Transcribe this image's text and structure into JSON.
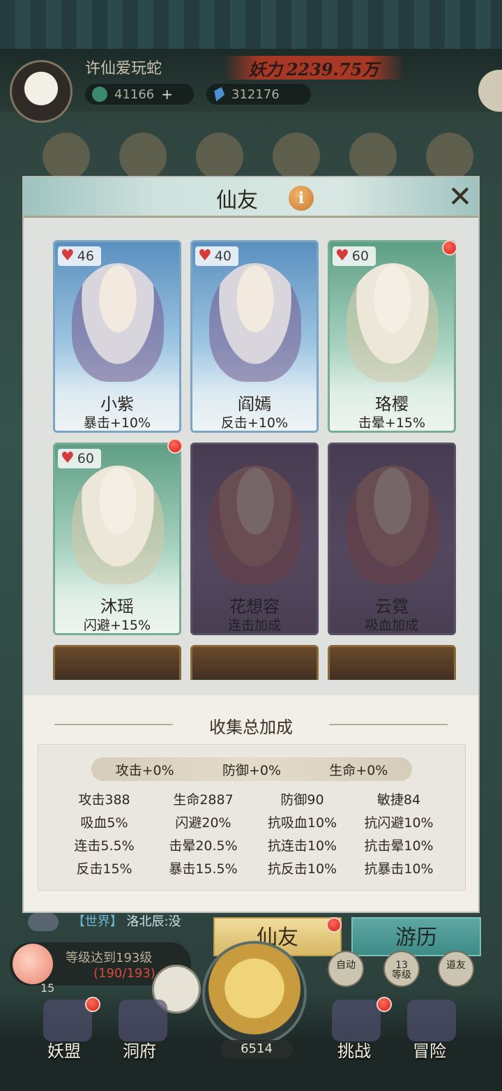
{
  "player": {
    "name": "许仙爱玩蛇",
    "power_label": "妖力",
    "power_value": "2239.75万",
    "coins": "41166",
    "gems": "312176"
  },
  "modal": {
    "title": "仙友",
    "info_icon_text": "i",
    "close_symbol": "✕",
    "cards": [
      {
        "name": "小紫",
        "bonus": "暴击+10%",
        "heart": "46",
        "style": "blue"
      },
      {
        "name": "阎嫣",
        "bonus": "反击+10%",
        "heart": "40",
        "style": "blue"
      },
      {
        "name": "珞樱",
        "bonus": "击晕+15%",
        "heart": "60",
        "style": "green"
      },
      {
        "name": "沐瑶",
        "bonus": "闪避+15%",
        "heart": "60",
        "style": "green"
      },
      {
        "name": "花想容",
        "bonus": "连击加成",
        "style": "locked"
      },
      {
        "name": "云霓",
        "bonus": "吸血加成",
        "style": "locked"
      }
    ],
    "collection": {
      "title": "收集总加成",
      "summary": [
        "攻击+0%",
        "防御+0%",
        "生命+0%"
      ],
      "stats": [
        "攻击388",
        "生命2887",
        "防御90",
        "敏捷84",
        "吸血5%",
        "闪避20%",
        "抗吸血10%",
        "抗闪避10%",
        "连击5.5%",
        "击晕20.5%",
        "抗连击10%",
        "抗击晕10%",
        "反击15%",
        "暴击15.5%",
        "抗反击10%",
        "抗暴击10%"
      ]
    }
  },
  "bottom": {
    "chat_channel": "【世界】",
    "chat_text": "洛北辰:没",
    "tab_xianyou": "仙友",
    "tab_youli": "游历",
    "level_text": "等级达到193级",
    "level_progress": "(190/193)",
    "level_number": "15",
    "auto_label": "自动",
    "grade_num": "13",
    "grade_label": "等级",
    "daoyou_label": "道友",
    "nav": [
      "妖盟",
      "洞府",
      "挑战",
      "冒险"
    ],
    "peach_count": "6514"
  },
  "colors": {
    "heart": "#d63b3b",
    "badge_red": "#d3201a",
    "tab_gold": "#d7b966",
    "tab_teal": "#3e8a86"
  }
}
